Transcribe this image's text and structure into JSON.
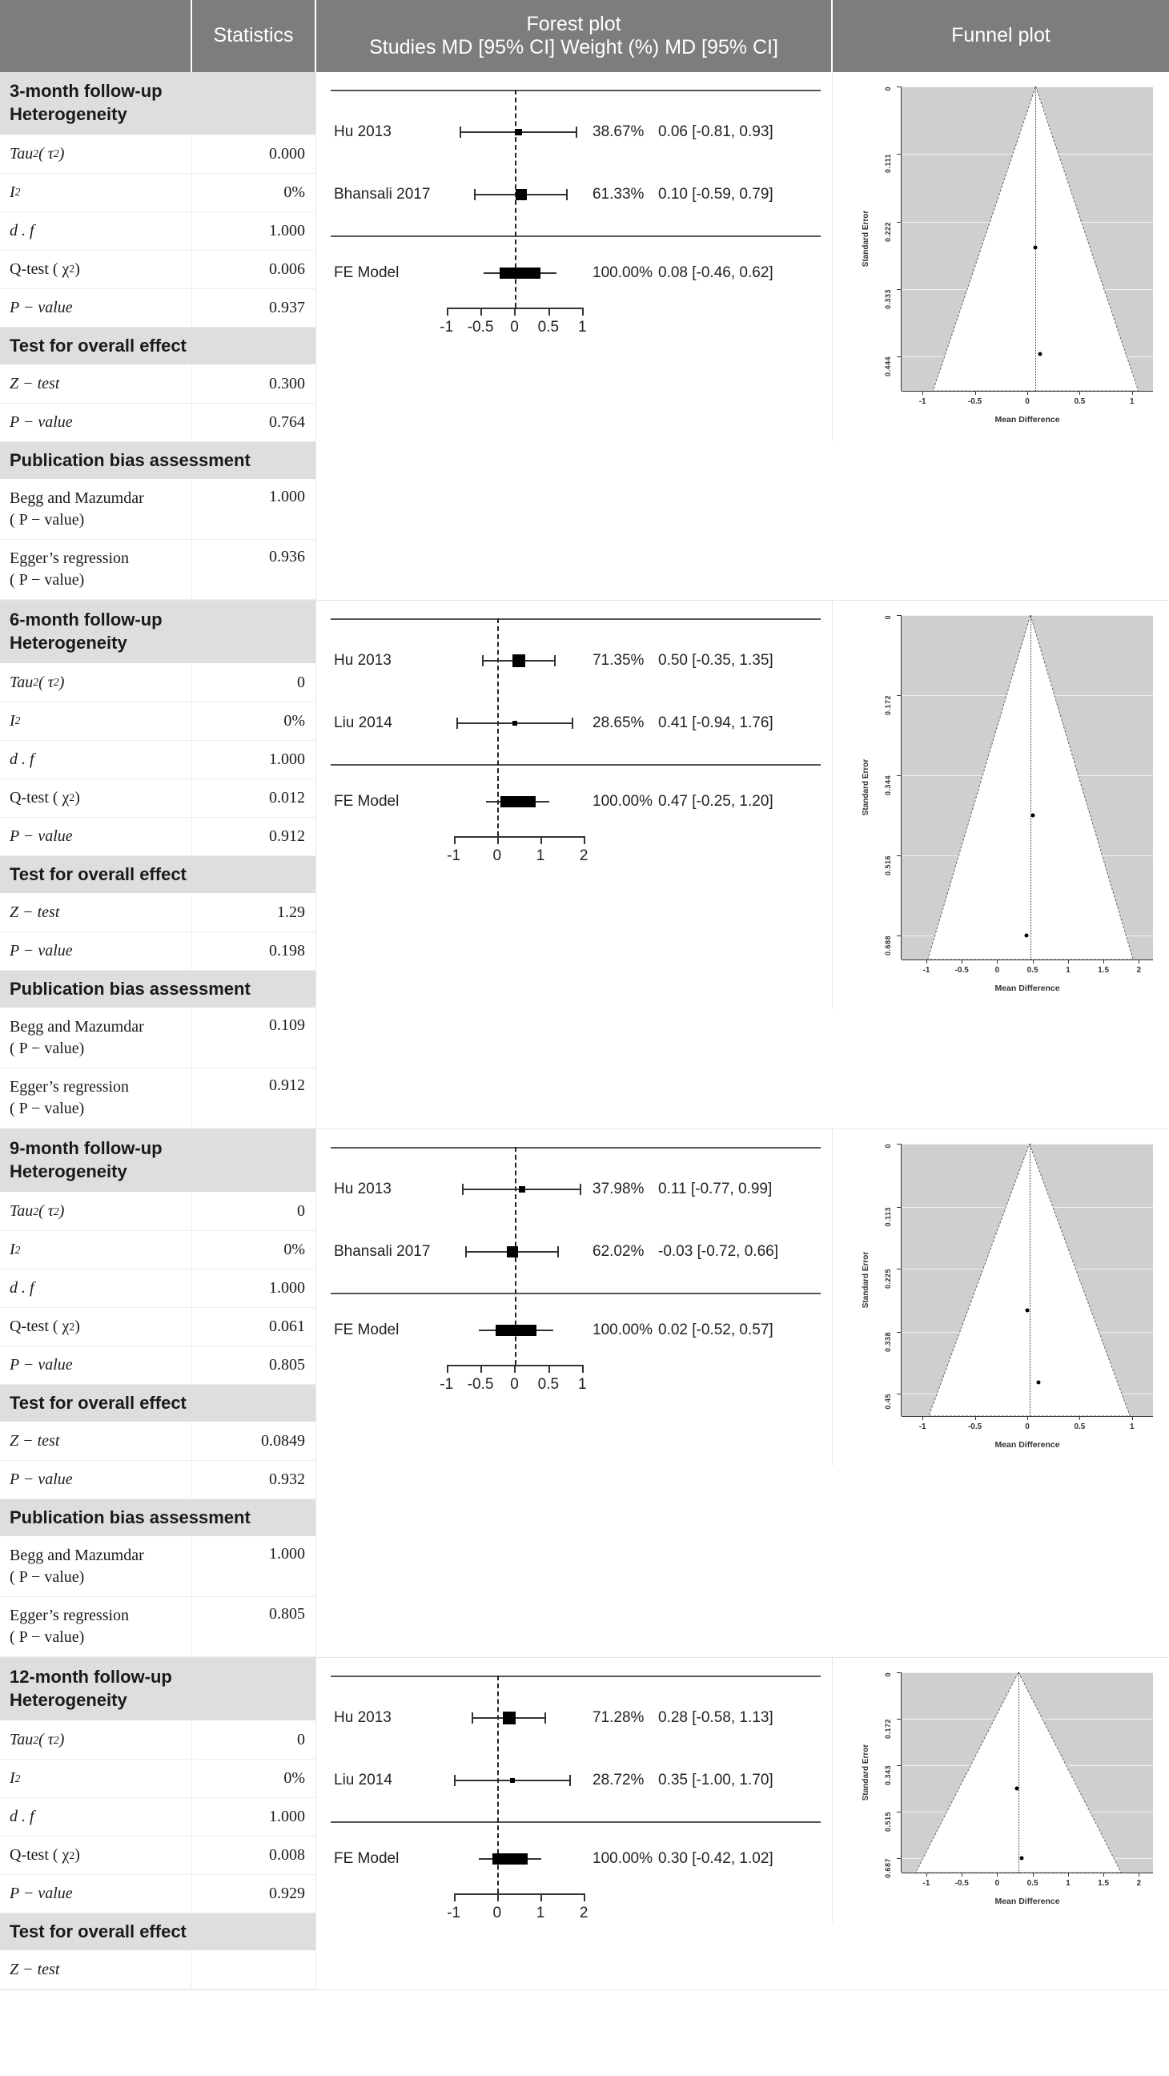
{
  "header": {
    "col_blank": "",
    "col_statistics": "Statistics",
    "forest_title": "Forest plot",
    "forest_sub": "Studies MD [95% CI] Weight (%) MD [95% CI]",
    "funnel_title": "Funnel plot"
  },
  "labels": {
    "heterogeneity": "Heterogeneity",
    "test_overall": "Test for overall effect",
    "pub_bias": "Publication bias assessment",
    "tau2": "Tau² ( τ²)",
    "i2": "I²",
    "df": "d . f",
    "qtest": "Q-test ( χ²)",
    "pvalue": "P − value",
    "ztest": "Z − test",
    "begg": "Begg and Mazumdar",
    "begg_sub": "( P − value)",
    "egger": "Egger’s regression",
    "egger_sub": "( P − value)"
  },
  "chart_data": [
    {
      "type": "forest",
      "section": "3-month follow-up",
      "title": "Forest plot",
      "xlabel": "",
      "xticks": [
        "-1",
        "-0.5",
        "0",
        "0.5",
        "1"
      ],
      "xtickvals": [
        -1,
        -0.5,
        0,
        0.5,
        1
      ],
      "xlim": [
        -1.15,
        1.15
      ],
      "zero_line": 0,
      "studies": [
        {
          "name": "Hu 2013",
          "weight": "38.67%",
          "est": "0.06 [-0.81, 0.93]",
          "md": 0.06,
          "lo": -0.81,
          "hi": 0.93,
          "wt": 38.67
        },
        {
          "name": "Bhansali 2017",
          "weight": "61.33%",
          "est": "0.10 [-0.59, 0.79]",
          "md": 0.1,
          "lo": -0.59,
          "hi": 0.79,
          "wt": 61.33
        }
      ],
      "summary": {
        "name": "FE Model",
        "weight": "100.00%",
        "est": "0.08 [-0.46, 0.62]",
        "md": 0.08,
        "lo": -0.46,
        "hi": 0.62
      }
    },
    {
      "type": "funnel",
      "section": "3-month follow-up",
      "title": "Funnel plot",
      "xlabel": "Mean Difference",
      "ylabel": "Standard Error",
      "yticks": [
        "0",
        "0.111",
        "0.222",
        "0.333",
        "0.444"
      ],
      "ytickvals": [
        0,
        0.111,
        0.222,
        0.333,
        0.444
      ],
      "xticks": [
        "-1",
        "-0.5",
        "0",
        "0.5",
        "1"
      ],
      "xtickvals": [
        -1,
        -0.5,
        0,
        0.5,
        1
      ],
      "xlim": [
        -1.2,
        1.2
      ],
      "ylim": [
        0,
        0.5
      ],
      "center": 0.08,
      "points": [
        {
          "x": 0.08,
          "se": 0.265
        },
        {
          "x": 0.12,
          "se": 0.44
        }
      ]
    },
    {
      "type": "forest",
      "section": "6-month follow-up",
      "title": "Forest plot",
      "xticks": [
        "-1",
        "0",
        "1",
        "2"
      ],
      "xtickvals": [
        -1,
        0,
        1,
        2
      ],
      "xlim": [
        -1.4,
        2.2
      ],
      "zero_line": 0,
      "studies": [
        {
          "name": "Hu 2013",
          "weight": "71.35%",
          "est": "0.50 [-0.35, 1.35]",
          "md": 0.5,
          "lo": -0.35,
          "hi": 1.35,
          "wt": 71.35
        },
        {
          "name": "Liu 2014",
          "weight": "28.65%",
          "est": "0.41 [-0.94, 1.76]",
          "md": 0.41,
          "lo": -0.94,
          "hi": 1.76,
          "wt": 28.65
        }
      ],
      "summary": {
        "name": "FE Model",
        "weight": "100.00%",
        "est": "0.47 [-0.25, 1.20]",
        "md": 0.47,
        "lo": -0.25,
        "hi": 1.2
      }
    },
    {
      "type": "funnel",
      "section": "6-month follow-up",
      "title": "Funnel plot",
      "xlabel": "Mean Difference",
      "ylabel": "Standard Error",
      "yticks": [
        "0",
        "0.172",
        "0.344",
        "0.516",
        "0.688"
      ],
      "ytickvals": [
        0,
        0.172,
        0.344,
        0.516,
        0.688
      ],
      "xticks": [
        "-1",
        "-0.5",
        "0",
        "0.5",
        "1",
        "1.5",
        "2"
      ],
      "xtickvals": [
        -1,
        -0.5,
        0,
        0.5,
        1,
        1.5,
        2
      ],
      "xlim": [
        -1.35,
        2.2
      ],
      "ylim": [
        0,
        0.74
      ],
      "center": 0.47,
      "points": [
        {
          "x": 0.5,
          "se": 0.43
        },
        {
          "x": 0.41,
          "se": 0.688
        }
      ]
    },
    {
      "type": "forest",
      "section": "9-month follow-up",
      "title": "Forest plot",
      "xticks": [
        "-1",
        "-0.5",
        "0",
        "0.5",
        "1"
      ],
      "xtickvals": [
        -1,
        -0.5,
        0,
        0.5,
        1
      ],
      "xlim": [
        -1.15,
        1.15
      ],
      "zero_line": 0,
      "studies": [
        {
          "name": "Hu 2013",
          "weight": "37.98%",
          "est": "0.11 [-0.77, 0.99]",
          "md": 0.11,
          "lo": -0.77,
          "hi": 0.99,
          "wt": 37.98
        },
        {
          "name": "Bhansali 2017",
          "weight": "62.02%",
          "est": "-0.03 [-0.72, 0.66]",
          "md": -0.03,
          "lo": -0.72,
          "hi": 0.66,
          "wt": 62.02
        }
      ],
      "summary": {
        "name": "FE Model",
        "weight": "100.00%",
        "est": "0.02 [-0.52, 0.57]",
        "md": 0.02,
        "lo": -0.52,
        "hi": 0.57
      }
    },
    {
      "type": "funnel",
      "section": "9-month follow-up",
      "title": "Funnel plot",
      "xlabel": "Mean Difference",
      "ylabel": "Standard Error",
      "yticks": [
        "0",
        "0.113",
        "0.225",
        "0.338",
        "0.45"
      ],
      "ytickvals": [
        0,
        0.113,
        0.225,
        0.338,
        0.45
      ],
      "xticks": [
        "-1",
        "-0.5",
        "0",
        "0.5",
        "1"
      ],
      "xtickvals": [
        -1,
        -0.5,
        0,
        0.5,
        1
      ],
      "xlim": [
        -1.2,
        1.2
      ],
      "ylim": [
        0,
        0.49
      ],
      "center": 0.02,
      "points": [
        {
          "x": 0.0,
          "se": 0.3
        },
        {
          "x": 0.11,
          "se": 0.43
        }
      ]
    },
    {
      "type": "forest",
      "section": "12-month follow-up",
      "title": "Forest plot",
      "xticks": [
        "-1",
        "0",
        "1",
        "2"
      ],
      "xtickvals": [
        -1,
        0,
        1,
        2
      ],
      "xlim": [
        -1.4,
        2.2
      ],
      "zero_line": 0,
      "studies": [
        {
          "name": "Hu 2013",
          "weight": "71.28%",
          "est": "0.28 [-0.58, 1.13]",
          "md": 0.28,
          "lo": -0.58,
          "hi": 1.13,
          "wt": 71.28
        },
        {
          "name": "Liu 2014",
          "weight": "28.72%",
          "est": "0.35 [-1.00, 1.70]",
          "md": 0.35,
          "lo": -1.0,
          "hi": 1.7,
          "wt": 28.72
        }
      ],
      "summary": {
        "name": "FE Model",
        "weight": "100.00%",
        "est": "0.30 [-0.42, 1.02]",
        "md": 0.3,
        "lo": -0.42,
        "hi": 1.02
      }
    },
    {
      "type": "funnel",
      "section": "12-month follow-up",
      "title": "Funnel plot",
      "xlabel": "Mean Difference",
      "ylabel": "Standard Error",
      "yticks": [
        "0",
        "0.172",
        "0.343",
        "0.515",
        "0.687"
      ],
      "ytickvals": [
        0,
        0.172,
        0.343,
        0.515,
        0.687
      ],
      "xticks": [
        "-1",
        "-0.5",
        "0",
        "0.5",
        "1",
        "1.5",
        "2"
      ],
      "xtickvals": [
        -1,
        -0.5,
        0,
        0.5,
        1,
        1.5,
        2
      ],
      "xlim": [
        -1.35,
        2.2
      ],
      "ylim": [
        0,
        0.74
      ],
      "center": 0.3,
      "points": [
        {
          "x": 0.28,
          "se": 0.43
        },
        {
          "x": 0.35,
          "se": 0.687
        }
      ]
    }
  ],
  "sections": [
    {
      "title": "3-month follow-up",
      "tau2": "0.000",
      "i2": "0%",
      "df": "1.000",
      "qtest": "0.006",
      "het_p": "0.937",
      "ztest": "0.300",
      "eff_p": "0.764",
      "begg": "1.000",
      "egger": "0.936"
    },
    {
      "title": "6-month follow-up",
      "tau2": "0",
      "i2": "0%",
      "df": "1.000",
      "qtest": "0.012",
      "het_p": "0.912",
      "ztest": "1.29",
      "eff_p": "0.198",
      "begg": "0.109",
      "egger": "0.912"
    },
    {
      "title": "9-month follow-up",
      "tau2": "0",
      "i2": "0%",
      "df": "1.000",
      "qtest": "0.061",
      "het_p": "0.805",
      "ztest": "0.0849",
      "eff_p": "0.932",
      "begg": "1.000",
      "egger": "0.805"
    },
    {
      "title": "12-month follow-up",
      "tau2": "0",
      "i2": "0%",
      "df": "1.000",
      "qtest": "0.008",
      "het_p": "0.929",
      "ztest": "",
      "eff_p": "",
      "begg": "",
      "egger": ""
    }
  ]
}
